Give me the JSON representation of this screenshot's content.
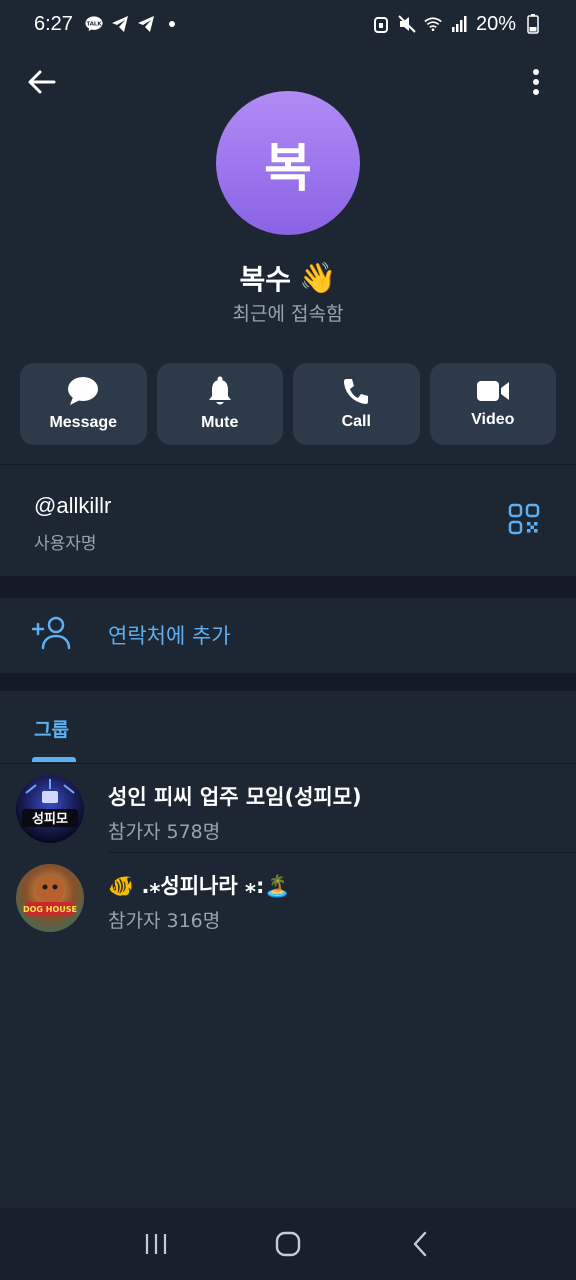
{
  "status_bar": {
    "time": "6:27",
    "battery": "20%",
    "left_icons": [
      "talk-icon",
      "telegram-icon",
      "telegram-icon"
    ],
    "right_icons": [
      "alarm-icon",
      "mute-icon",
      "wifi-icon",
      "signal-icon",
      "battery-icon"
    ]
  },
  "profile": {
    "avatar_text": "복",
    "name": "복수",
    "emoji": "👋",
    "status": "최근에 접속함"
  },
  "actions": [
    {
      "label": "Message",
      "icon": "message-icon"
    },
    {
      "label": "Mute",
      "icon": "bell-icon"
    },
    {
      "label": "Call",
      "icon": "phone-icon"
    },
    {
      "label": "Video",
      "icon": "video-icon"
    }
  ],
  "info": {
    "username": "@allkillr",
    "username_label": "사용자명"
  },
  "add_contact": {
    "label": "연락처에 추가"
  },
  "groups_tab": {
    "label": "그룹"
  },
  "groups": [
    {
      "name": "성인 피씨 업주 모임(성피모)",
      "members": "참가자 578명",
      "avatar_text": "성피모"
    },
    {
      "name": "🐠 .⁎성피나라 ⁎:🏝️",
      "members": "참가자 316명",
      "avatar_text": "DOG HOUSE"
    }
  ],
  "colors": {
    "background": "#1d2733",
    "card": "#2c3a4a",
    "accent": "#5eaff2",
    "secondary_text": "#98a3ae"
  }
}
